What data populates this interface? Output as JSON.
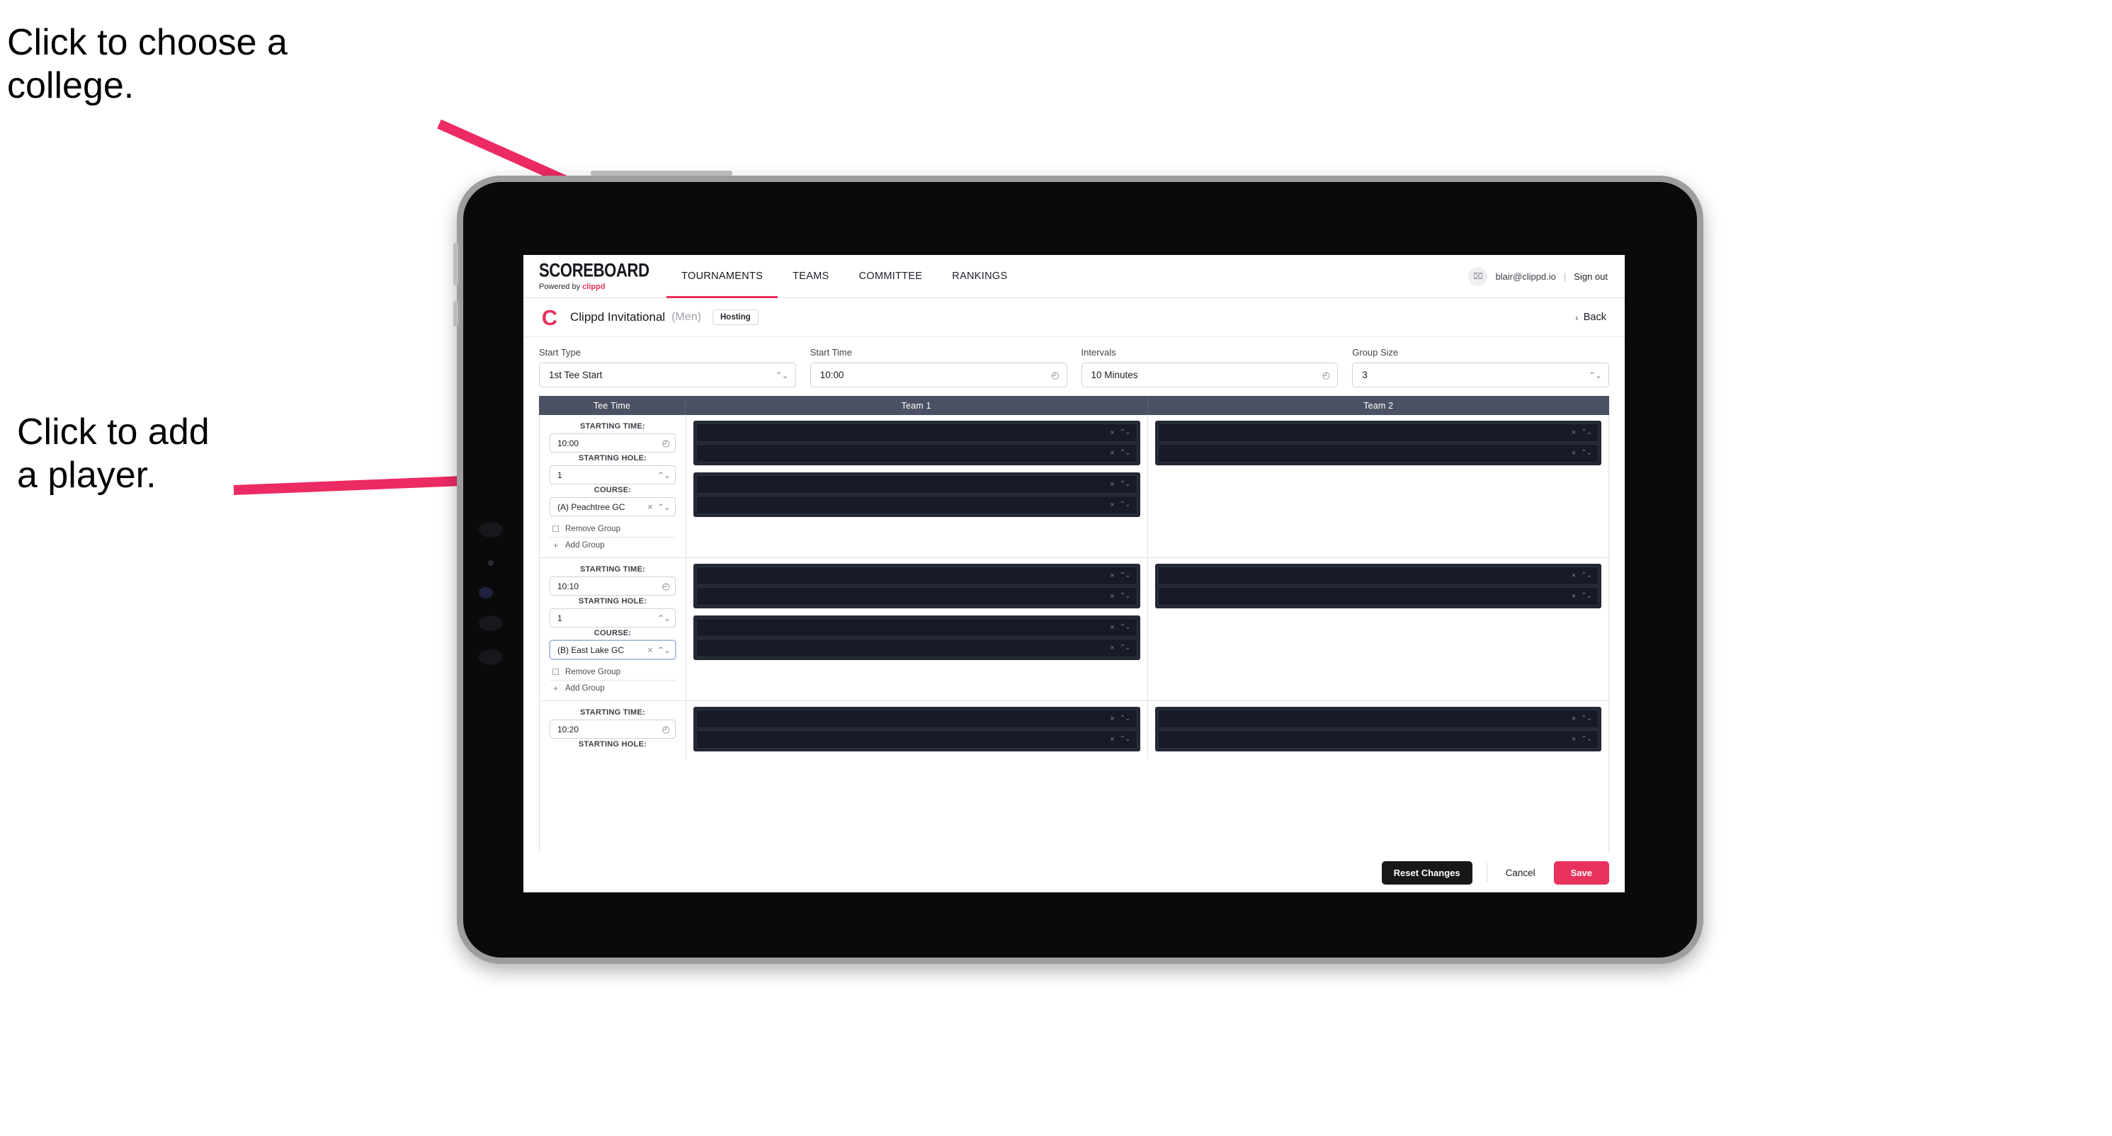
{
  "annotations": {
    "college": "Click to choose a\ncollege.",
    "player": "Click to add\na player."
  },
  "colors": {
    "accent": "#e8315c",
    "table_header": "#4b5163",
    "slot_dark": "#171b26",
    "group_dark": "#232834",
    "dark_button": "#18181b"
  },
  "topnav": {
    "brand_word": "SCOREBOARD",
    "brand_sub_prefix": "Powered by ",
    "brand_sub_name": "clippd",
    "tabs": [
      {
        "label": "TOURNAMENTS",
        "active": true
      },
      {
        "label": "TEAMS",
        "active": false
      },
      {
        "label": "COMMITTEE",
        "active": false
      },
      {
        "label": "RANKINGS",
        "active": false
      }
    ],
    "account": {
      "avatar_glyph": "⌧",
      "email": "blair@clippd.io",
      "separator": "|",
      "signout": "Sign out"
    }
  },
  "tournament_header": {
    "logo_glyph": "C",
    "name": "Clippd Invitational",
    "gender": "(Men)",
    "badge": "Hosting",
    "back_chevron": "‹",
    "back_label": "Back"
  },
  "settings": {
    "fields": [
      {
        "label": "Start Type",
        "value": "1st Tee Start",
        "icon": "stepper-icon",
        "glyph": "⌃⌄"
      },
      {
        "label": "Start Time",
        "value": "10:00",
        "icon": "clock-icon",
        "glyph": "◴"
      },
      {
        "label": "Intervals",
        "value": "10 Minutes",
        "icon": "clock-icon",
        "glyph": "◴"
      },
      {
        "label": "Group Size",
        "value": "3",
        "icon": "stepper-icon",
        "glyph": "⌃⌄"
      }
    ]
  },
  "table": {
    "headers": {
      "tee_time": "Tee Time",
      "team1": "Team 1",
      "team2": "Team 2"
    },
    "labels": {
      "starting_time": "STARTING TIME:",
      "starting_hole": "STARTING HOLE:",
      "course": "COURSE:",
      "remove_group": "Remove Group",
      "add_group": "Add Group",
      "remove_icon": "☐",
      "add_icon": "+",
      "clear_icon": "×",
      "stepper_icon": "⌃⌄",
      "clock_icon": "◴"
    },
    "rows": [
      {
        "starting_time": "10:00",
        "starting_hole": "1",
        "course": "(A) Peachtree GC",
        "course_focused": false,
        "team1_groups": [
          {
            "slots": 2
          },
          {
            "slots": 2
          }
        ],
        "team2_groups": [
          {
            "slots": 2
          }
        ]
      },
      {
        "starting_time": "10:10",
        "starting_hole": "1",
        "course": "(B) East Lake GC",
        "course_focused": true,
        "team1_groups": [
          {
            "slots": 2
          },
          {
            "slots": 2
          }
        ],
        "team2_groups": [
          {
            "slots": 2
          }
        ]
      },
      {
        "starting_time": "10:20",
        "starting_hole": "",
        "course": "",
        "course_focused": false,
        "team1_groups": [
          {
            "slots": 2
          }
        ],
        "team2_groups": [
          {
            "slots": 2
          }
        ]
      }
    ]
  },
  "footer": {
    "reset": "Reset Changes",
    "cancel": "Cancel",
    "save": "Save"
  }
}
